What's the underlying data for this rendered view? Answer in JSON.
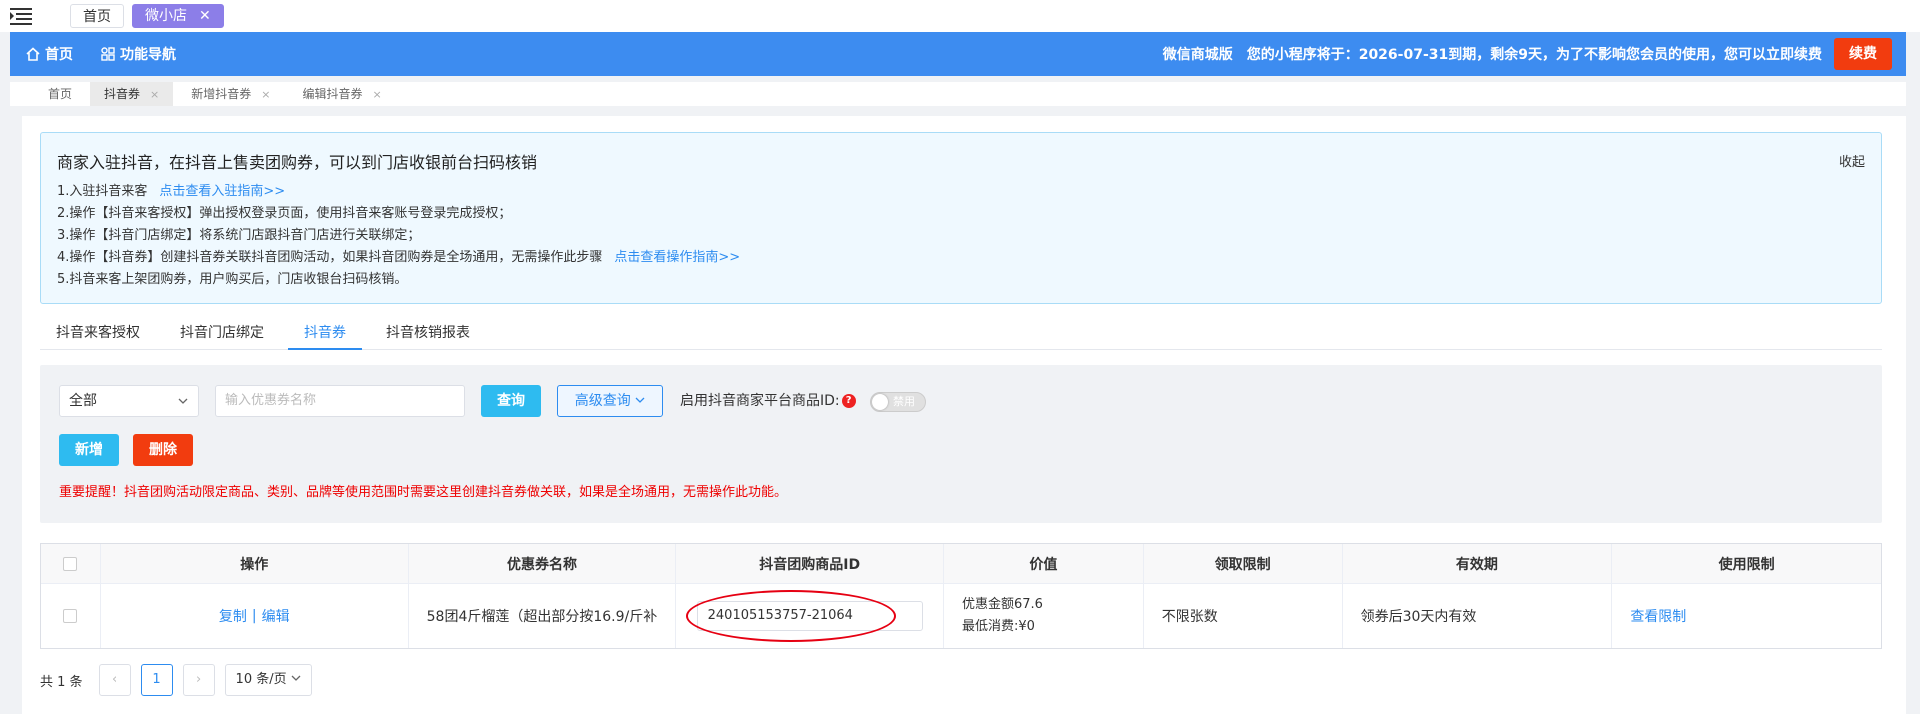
{
  "topbar": {
    "tabs": [
      {
        "label": "首页"
      },
      {
        "label": "微小店",
        "close": "✕"
      }
    ]
  },
  "header": {
    "nav": [
      {
        "label": "首页",
        "icon": "home-icon"
      },
      {
        "label": "功能导航",
        "icon": "grid-icon"
      }
    ],
    "edition": "微信商城版",
    "notice": "您的小程序将于：2026-07-31到期，剩余9天，为了不影响您会员的使用，您可以立即续费",
    "renew_label": "续费",
    "accent": "#3d8cf0",
    "danger": "#f23c0f"
  },
  "subtabs": [
    {
      "label": "首页"
    },
    {
      "label": "抖音券",
      "close": "×"
    },
    {
      "label": "新增抖音券",
      "close": "×"
    },
    {
      "label": "编辑抖音券",
      "close": "×"
    }
  ],
  "info": {
    "title": "商家入驻抖音，在抖音上售卖团购券，可以到门店收银前台扫码核销",
    "collapse": "收起",
    "lines": [
      {
        "text": "1.入驻抖音来客",
        "link": "点击查看入驻指南>>"
      },
      {
        "text": "2.操作【抖音来客授权】弹出授权登录页面，使用抖音来客账号登录完成授权；"
      },
      {
        "text": "3.操作【抖音门店绑定】将系统门店跟抖音门店进行关联绑定；"
      },
      {
        "text": "4.操作【抖音券】创建抖音券关联抖音团购活动，如果抖音团购券是全场通用，无需操作此步骤",
        "link": "点击查看操作指南>>"
      },
      {
        "text": "5.抖音来客上架团购券，用户购买后，门店收银台扫码核销。"
      }
    ]
  },
  "tabs": [
    {
      "label": "抖音来客授权"
    },
    {
      "label": "抖音门店绑定"
    },
    {
      "label": "抖音券"
    },
    {
      "label": "抖音核销报表"
    }
  ],
  "filter": {
    "select_value": "全部",
    "search_placeholder": "输入优惠券名称",
    "query_label": "查询",
    "advanced_label": "高级查询",
    "switch_label": "启用抖音商家平台商品ID:",
    "switch_state": "禁用",
    "add_label": "新增",
    "delete_label": "删除",
    "warning": "重要提醒！抖音团购活动限定商品、类别、品牌等使用范围时需要这里创建抖音券做关联，如果是全场通用，无需操作此功能。"
  },
  "table": {
    "headers": [
      "操作",
      "优惠券名称",
      "抖音团购商品ID",
      "价值",
      "领取限制",
      "有效期",
      "使用限制"
    ],
    "rows": [
      {
        "copy": "复制",
        "sep": "|",
        "edit": "编辑",
        "name": "58团4斤榴莲（超出部分按16.9/斤补",
        "product_id": "240105153757-21064",
        "value_amount": "优惠金额67.6",
        "value_min": "最低消费:¥0",
        "limit": "不限张数",
        "validity": "领券后30天内有效",
        "usage": "查看限制"
      }
    ]
  },
  "pager": {
    "total": "共 1 条",
    "prev": "‹",
    "page": "1",
    "next": "›",
    "size": "10 条/页"
  }
}
